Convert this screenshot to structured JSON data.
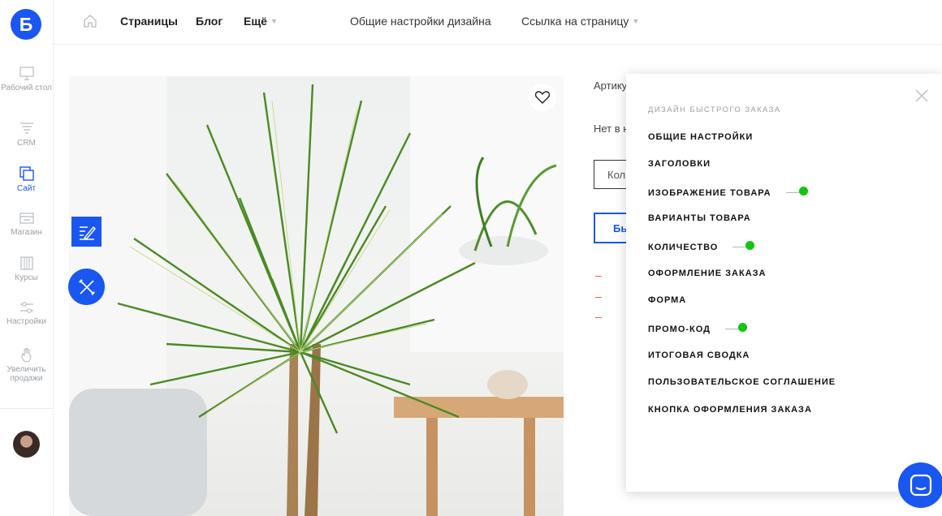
{
  "logo": {
    "letter": "Б"
  },
  "sidebar": {
    "items": [
      {
        "label": "Рабочий стол",
        "icon": "monitor-icon"
      },
      {
        "label": "CRM",
        "icon": "funnel-icon"
      },
      {
        "label": "Сайт",
        "icon": "site-icon",
        "active": true
      },
      {
        "label": "Магазин",
        "icon": "store-icon"
      },
      {
        "label": "Курсы",
        "icon": "books-icon"
      },
      {
        "label": "Настройки",
        "icon": "sliders-icon"
      },
      {
        "label": "Увеличить продажи",
        "icon": "hand-icon"
      }
    ]
  },
  "topbar": {
    "pages": "Страницы",
    "blog": "Блог",
    "more": "Ещё",
    "design": "Общие настройки дизайна",
    "link": "Ссылка на страницу"
  },
  "product": {
    "article": "Артику",
    "stock": "Нет в н",
    "qty_placeholder": "Кол",
    "buy_label": "Бы",
    "dashes": [
      "–",
      "–",
      "–"
    ]
  },
  "panel": {
    "title": "Дизайн быстрого заказа",
    "items": [
      {
        "label": "Общие настройки",
        "on": false
      },
      {
        "label": "Заголовки",
        "on": false
      },
      {
        "label": "Изображение товара",
        "on": true
      },
      {
        "label": "Варианты товара",
        "on": false
      },
      {
        "label": "Количество",
        "on": true
      },
      {
        "label": "Оформление заказа",
        "on": false
      },
      {
        "label": "Форма",
        "on": false
      },
      {
        "label": "Промо-код",
        "on": true
      },
      {
        "label": "Итоговая сводка",
        "on": false
      },
      {
        "label": "Пользовательское соглашение",
        "on": false
      },
      {
        "label": "Кнопка оформления заказа",
        "on": false
      }
    ]
  },
  "colors": {
    "accent": "#1a56f0",
    "toggle_on": "#11c611",
    "dash": "#e8553e"
  }
}
